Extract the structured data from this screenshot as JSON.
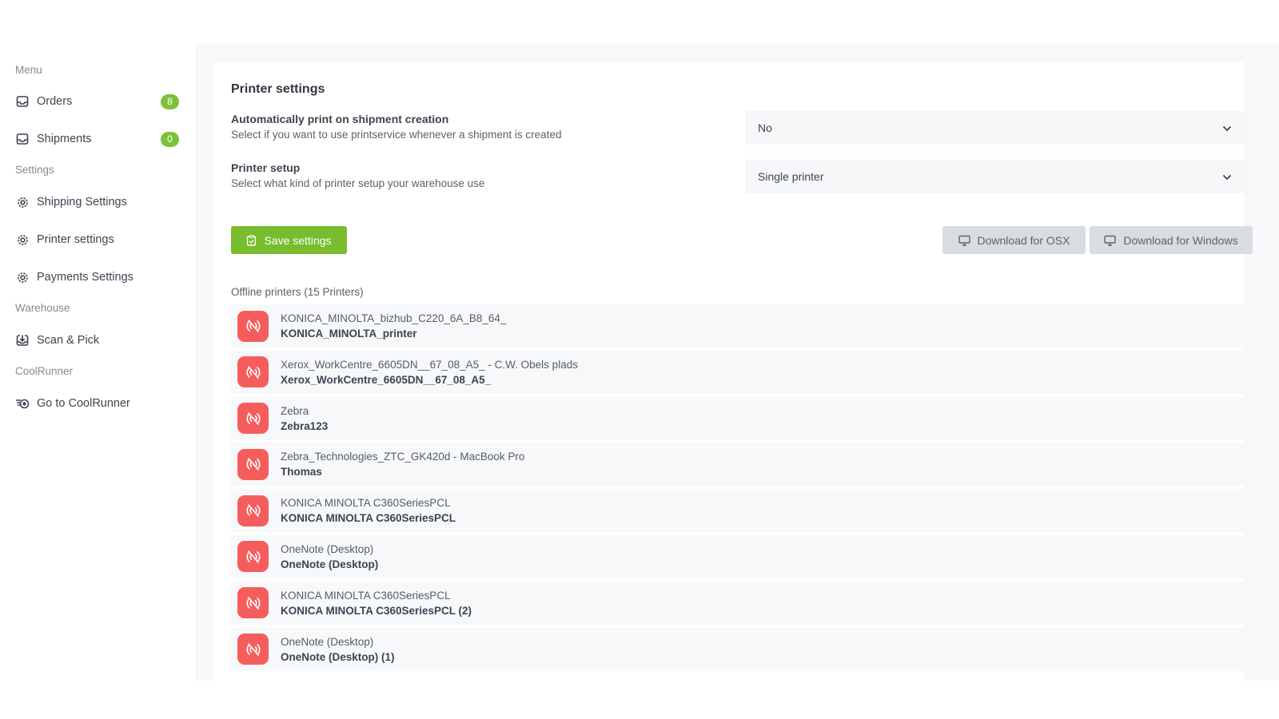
{
  "sidebar": {
    "sections": {
      "menu": "Menu",
      "settings": "Settings",
      "warehouse": "Warehouse",
      "coolrunner": "CoolRunner"
    },
    "items": [
      {
        "label": "Orders",
        "badge": "8",
        "icon": "inbox-icon"
      },
      {
        "label": "Shipments",
        "badge": "0",
        "icon": "inbox-icon"
      },
      {
        "label": "Shipping Settings",
        "icon": "gear-icon"
      },
      {
        "label": "Printer settings",
        "icon": "gear-icon"
      },
      {
        "label": "Payments Settings",
        "icon": "gear-icon"
      },
      {
        "label": "Scan & Pick",
        "icon": "download-box-icon"
      },
      {
        "label": "Go to CoolRunner",
        "icon": "coolrunner-logo-icon"
      }
    ]
  },
  "panel": {
    "title": "Printer settings",
    "auto_print": {
      "label": "Automatically print on shipment creation",
      "description": "Select if you want to use printservice whenever a shipment is created",
      "value": "No"
    },
    "printer_setup": {
      "label": "Printer setup",
      "description": "Select what kind of printer setup your warehouse use",
      "value": "Single printer"
    },
    "save_label": "Save settings",
    "download_osx_label": "Download for OSX",
    "download_windows_label": "Download for Windows",
    "offline_title": "Offline printers (15 Printers)",
    "printers": [
      {
        "name": "KONICA_MINOLTA_bizhub_C220_6A_B8_64_",
        "sub": "KONICA_MINOLTA_printer"
      },
      {
        "name": "Xerox_WorkCentre_6605DN__67_08_A5_ - C.W. Obels plads",
        "sub": "Xerox_WorkCentre_6605DN__67_08_A5_"
      },
      {
        "name": "Zebra",
        "sub": "Zebra123"
      },
      {
        "name": "Zebra_Technologies_ZTC_GK420d - MacBook Pro",
        "sub": "Thomas"
      },
      {
        "name": "KONICA MINOLTA C360SeriesPCL",
        "sub": "KONICA MINOLTA C360SeriesPCL"
      },
      {
        "name": "OneNote (Desktop)",
        "sub": "OneNote (Desktop)"
      },
      {
        "name": "KONICA MINOLTA C360SeriesPCL",
        "sub": "KONICA MINOLTA C360SeriesPCL (2)"
      },
      {
        "name": "OneNote (Desktop)",
        "sub": "OneNote (Desktop) (1)"
      }
    ]
  },
  "colors": {
    "accent_green": "#77bd2e",
    "badge_green": "#7dc13a",
    "offline_red": "#f55d5d"
  }
}
